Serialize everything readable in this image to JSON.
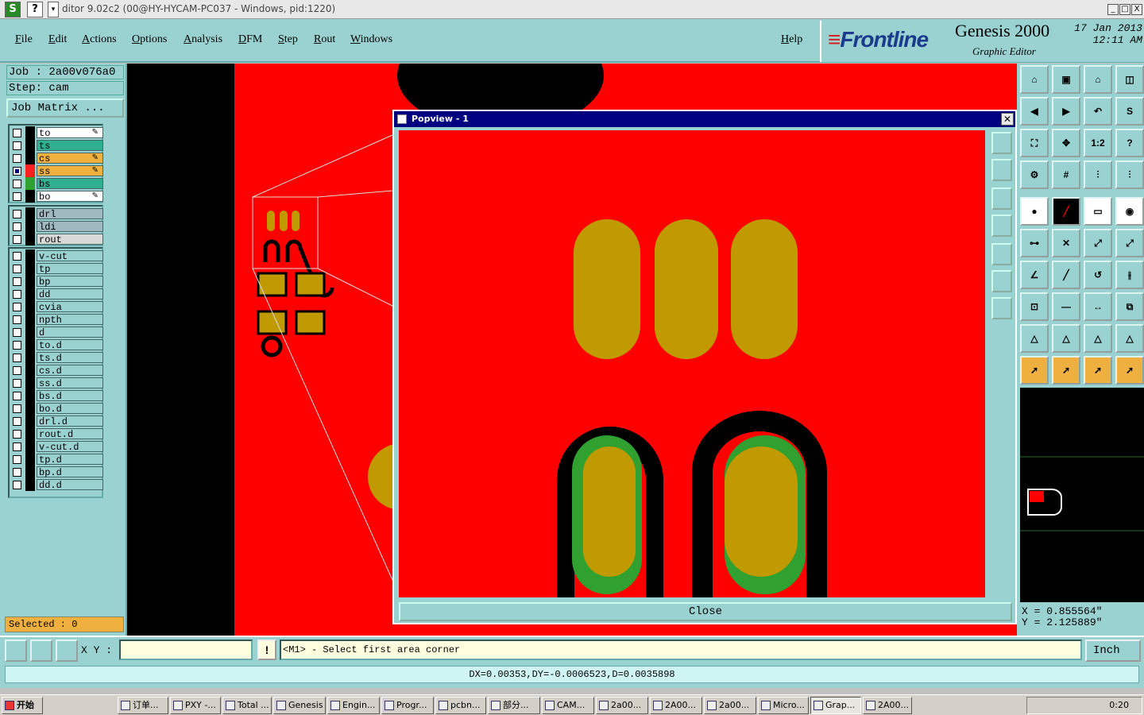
{
  "window": {
    "title": "ditor 9.02c2 (00@HY-HYCAM-PC037 - Windows, pid:1220)",
    "controls": [
      "_",
      "□",
      "X"
    ]
  },
  "menu": {
    "items": [
      "File",
      "Edit",
      "Actions",
      "Options",
      "Analysis",
      "DFM",
      "Step",
      "Rout",
      "Windows"
    ],
    "help": "Help"
  },
  "brand": {
    "logo": "Frontline",
    "product": "Genesis 2000",
    "subtitle": "Graphic Editor",
    "date": "17 Jan 2013",
    "time": "12:11 AM"
  },
  "job": {
    "job_line": "Job : 2a00v076a0",
    "step_line": "Step: cam",
    "matrix_button": "Job Matrix ..."
  },
  "layers": {
    "board": [
      {
        "name": "to",
        "color": "#ffffff",
        "swatch": "#000000",
        "icon": "pen"
      },
      {
        "name": "ts",
        "color": "#30b090",
        "swatch": "#000000",
        "icon": ""
      },
      {
        "name": "cs",
        "color": "#f0b040",
        "swatch": "#000000",
        "icon": "pen"
      },
      {
        "name": "ss",
        "color": "#f0b040",
        "swatch": "#ff2020",
        "icon": "pen-active",
        "checked": true
      },
      {
        "name": "bs",
        "color": "#30b090",
        "swatch": "#30a030",
        "icon": ""
      },
      {
        "name": "bo",
        "color": "#ffffff",
        "swatch": "#000000",
        "icon": "pen"
      }
    ],
    "drill": [
      "drl",
      "ldi",
      "rout"
    ],
    "misc": [
      "v-cut",
      "tp",
      "bp",
      "dd",
      "cvia",
      "npth",
      "d",
      "to.d",
      "ts.d",
      "cs.d",
      "ss.d",
      "bs.d",
      "bo.d",
      "drl.d",
      "rout.d",
      "v-cut.d",
      "tp.d",
      "bp.d",
      "dd.d"
    ]
  },
  "selected": "Selected : 0",
  "popview": {
    "title": "Popview - 1",
    "close_button": "Close"
  },
  "coords": {
    "x": "X = 0.855564\"",
    "y": "Y = 2.125889\""
  },
  "command": {
    "xy_label": "X Y :",
    "xy_value": "",
    "exclaim": "!",
    "prompt": "<M1> - Select first area corner",
    "unit": "Inch"
  },
  "status": "DX=0.00353,DY=-0.0006523,D=0.0035898",
  "taskbar": {
    "start": "开始",
    "tasks": [
      "订单...",
      "PXY -...",
      "Total ...",
      "Genesis",
      "Engin...",
      "Progr...",
      "pcbn...",
      "部分...",
      "CAM...",
      "2a00...",
      "2A00...",
      "2a00...",
      "Micro...",
      "Grap...",
      "2A00..."
    ],
    "clock": "0:20"
  },
  "colors": {
    "panel": "#9ad2d2",
    "copper": "#ff0000",
    "pad": "#c09a00",
    "mask": "#30a030"
  }
}
